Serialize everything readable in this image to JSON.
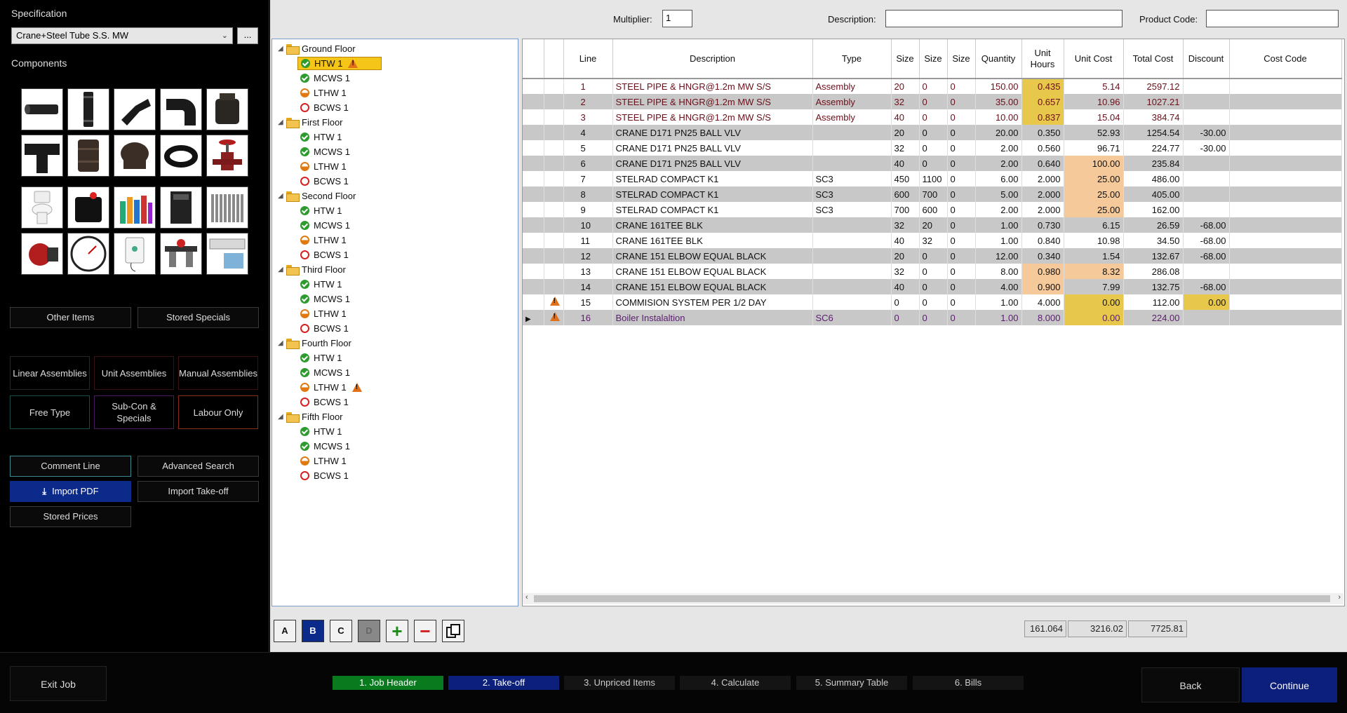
{
  "left": {
    "spec_label": "Specification",
    "spec_value": "Crane+Steel Tube S.S. MW",
    "spec_more": "...",
    "components_label": "Components",
    "components": [
      "pipe",
      "nipple",
      "elbow-45",
      "elbow",
      "cap-fitting",
      "tee",
      "socket",
      "plug",
      "flexible-hose",
      "gate-valve",
      "toilet",
      "pump-unit",
      "bottles",
      "boiler",
      "radiator",
      "circulator-pump",
      "pressure-gauge",
      "water-heater",
      "filter-regulator",
      "air-conditioner"
    ],
    "other_items": "Other Items",
    "stored_specials": "Stored Specials",
    "linear_assemblies": "Linear Assemblies",
    "unit_assemblies": "Unit Assemblies",
    "manual_assemblies": "Manual Assemblies",
    "free_type": "Free Type",
    "subcon": "Sub-Con & Specials",
    "labour_only": "Labour Only",
    "comment_line": "Comment Line",
    "advanced_search": "Advanced Search",
    "import_pdf": "Import PDF",
    "import_takeoff": "Import Take-off",
    "stored_prices": "Stored Prices"
  },
  "topbar": {
    "multiplier_label": "Multiplier:",
    "multiplier_value": "1",
    "description_label": "Description:",
    "description_value": "",
    "product_code_label": "Product Code:",
    "product_code_value": ""
  },
  "tree": {
    "floors": [
      {
        "name": "Ground Floor",
        "items": [
          {
            "label": "HTW  1",
            "status": "ok",
            "warn": true,
            "selected": true
          },
          {
            "label": "MCWS  1",
            "status": "ok"
          },
          {
            "label": "LTHW  1",
            "status": "half"
          },
          {
            "label": "BCWS  1",
            "status": "empty"
          }
        ]
      },
      {
        "name": "First Floor",
        "items": [
          {
            "label": "HTW  1",
            "status": "ok"
          },
          {
            "label": "MCWS  1",
            "status": "ok"
          },
          {
            "label": "LTHW  1",
            "status": "half"
          },
          {
            "label": "BCWS  1",
            "status": "empty"
          }
        ]
      },
      {
        "name": "Second Floor",
        "items": [
          {
            "label": "HTW  1",
            "status": "ok"
          },
          {
            "label": "MCWS  1",
            "status": "ok"
          },
          {
            "label": "LTHW  1",
            "status": "half"
          },
          {
            "label": "BCWS  1",
            "status": "empty"
          }
        ]
      },
      {
        "name": "Third Floor",
        "items": [
          {
            "label": "HTW  1",
            "status": "ok"
          },
          {
            "label": "MCWS  1",
            "status": "ok"
          },
          {
            "label": "LTHW  1",
            "status": "half"
          },
          {
            "label": "BCWS  1",
            "status": "empty"
          }
        ]
      },
      {
        "name": "Fourth Floor",
        "items": [
          {
            "label": "HTW  1",
            "status": "ok"
          },
          {
            "label": "MCWS  1",
            "status": "ok"
          },
          {
            "label": "LTHW  1",
            "status": "half",
            "warn": true
          },
          {
            "label": "BCWS  1",
            "status": "empty"
          }
        ]
      },
      {
        "name": "Fifth Floor",
        "items": [
          {
            "label": "HTW  1",
            "status": "ok"
          },
          {
            "label": "MCWS  1",
            "status": "ok"
          },
          {
            "label": "LTHW  1",
            "status": "half"
          },
          {
            "label": "BCWS  1",
            "status": "empty"
          }
        ]
      }
    ],
    "buttons": [
      "A",
      "B",
      "C",
      "D"
    ]
  },
  "grid": {
    "columns": [
      "",
      "",
      "Line",
      "Description",
      "Type",
      "Size",
      "Size",
      "Size",
      "Quantity",
      "Unit Hours",
      "Unit Cost",
      "Total Cost",
      "Discount",
      "Cost Code"
    ],
    "rows": [
      {
        "line": "1",
        "desc": "STEEL PIPE & HNGR@1.2m MW S/S",
        "type": "Assembly",
        "s1": "20",
        "s2": "0",
        "s3": "0",
        "qty": "150.00",
        "hrs": "0.435",
        "cost": "5.14",
        "total": "2597.12",
        "disc": "",
        "code": "",
        "color": "maroon",
        "hrs_hl": "y"
      },
      {
        "line": "2",
        "desc": "STEEL PIPE & HNGR@1.2m MW S/S",
        "type": "Assembly",
        "s1": "32",
        "s2": "0",
        "s3": "0",
        "qty": "35.00",
        "hrs": "0.657",
        "cost": "10.96",
        "total": "1027.21",
        "disc": "",
        "code": "",
        "color": "maroon",
        "hrs_hl": "y"
      },
      {
        "line": "3",
        "desc": "STEEL PIPE & HNGR@1.2m MW S/S",
        "type": "Assembly",
        "s1": "40",
        "s2": "0",
        "s3": "0",
        "qty": "10.00",
        "hrs": "0.837",
        "cost": "15.04",
        "total": "384.74",
        "disc": "",
        "code": "",
        "color": "maroon",
        "hrs_hl": "y"
      },
      {
        "line": "4",
        "desc": "CRANE D171 PN25   BALL VLV",
        "type": "",
        "s1": "20",
        "s2": "0",
        "s3": "0",
        "qty": "20.00",
        "hrs": "0.350",
        "cost": "52.93",
        "total": "1254.54",
        "disc": "-30.00",
        "code": ""
      },
      {
        "line": "5",
        "desc": "CRANE D171 PN25   BALL VLV",
        "type": "",
        "s1": "32",
        "s2": "0",
        "s3": "0",
        "qty": "2.00",
        "hrs": "0.560",
        "cost": "96.71",
        "total": "224.77",
        "disc": "-30.00",
        "code": ""
      },
      {
        "line": "6",
        "desc": "CRANE D171 PN25   BALL VLV",
        "type": "",
        "s1": "40",
        "s2": "0",
        "s3": "0",
        "qty": "2.00",
        "hrs": "0.640",
        "cost": "100.00",
        "total": "235.84",
        "disc": "",
        "code": "",
        "cost_hl": "o"
      },
      {
        "line": "7",
        "desc": "STELRAD COMPACT K1",
        "type": "SC3",
        "s1": "450",
        "s2": "1100",
        "s3": "0",
        "qty": "6.00",
        "hrs": "2.000",
        "cost": "25.00",
        "total": "486.00",
        "disc": "",
        "code": "",
        "cost_hl": "o"
      },
      {
        "line": "8",
        "desc": "STELRAD COMPACT K1",
        "type": "SC3",
        "s1": "600",
        "s2": "700",
        "s3": "0",
        "qty": "5.00",
        "hrs": "2.000",
        "cost": "25.00",
        "total": "405.00",
        "disc": "",
        "code": "",
        "cost_hl": "o"
      },
      {
        "line": "9",
        "desc": "STELRAD COMPACT K1",
        "type": "SC3",
        "s1": "700",
        "s2": "600",
        "s3": "0",
        "qty": "2.00",
        "hrs": "2.000",
        "cost": "25.00",
        "total": "162.00",
        "disc": "",
        "code": "",
        "cost_hl": "o"
      },
      {
        "line": "10",
        "desc": "CRANE 161TEE BLK",
        "type": "",
        "s1": "32",
        "s2": "20",
        "s3": "0",
        "qty": "1.00",
        "hrs": "0.730",
        "cost": "6.15",
        "total": "26.59",
        "disc": "-68.00",
        "code": ""
      },
      {
        "line": "11",
        "desc": "CRANE 161TEE BLK",
        "type": "",
        "s1": "40",
        "s2": "32",
        "s3": "0",
        "qty": "1.00",
        "hrs": "0.840",
        "cost": "10.98",
        "total": "34.50",
        "disc": "-68.00",
        "code": ""
      },
      {
        "line": "12",
        "desc": "CRANE 151 ELBOW EQUAL BLACK",
        "type": "",
        "s1": "20",
        "s2": "0",
        "s3": "0",
        "qty": "12.00",
        "hrs": "0.340",
        "cost": "1.54",
        "total": "132.67",
        "disc": "-68.00",
        "code": ""
      },
      {
        "line": "13",
        "desc": "CRANE 151 ELBOW EQUAL BLACK",
        "type": "",
        "s1": "32",
        "s2": "0",
        "s3": "0",
        "qty": "8.00",
        "hrs": "0.980",
        "cost": "8.32",
        "total": "286.08",
        "disc": "",
        "code": "",
        "hrs_hl": "o",
        "cost_hl": "o"
      },
      {
        "line": "14",
        "desc": "CRANE 151 ELBOW EQUAL BLACK",
        "type": "",
        "s1": "40",
        "s2": "0",
        "s3": "0",
        "qty": "4.00",
        "hrs": "0.900",
        "cost": "7.99",
        "total": "132.75",
        "disc": "-68.00",
        "code": "",
        "hrs_hl": "o"
      },
      {
        "line": "15",
        "desc": "COMMISION SYSTEM PER 1/2  DAY",
        "type": "",
        "s1": "0",
        "s2": "0",
        "s3": "0",
        "qty": "1.00",
        "hrs": "4.000",
        "cost": "0.00",
        "total": "112.00",
        "disc": "0.00",
        "code": "",
        "warn": true,
        "cost_hl": "y",
        "disc_hl": "y"
      },
      {
        "line": "16",
        "desc": "Boiler Instalaltion",
        "type": "SC6",
        "s1": "0",
        "s2": "0",
        "s3": "0",
        "qty": "1.00",
        "hrs": "8.000",
        "cost": "0.00",
        "total": "224.00",
        "disc": "",
        "code": "",
        "warn": true,
        "current": true,
        "color": "purple",
        "cost_hl": "y"
      }
    ],
    "totals": {
      "hours": "161.064",
      "cost": "3216.02",
      "total": "7725.81"
    }
  },
  "bottom": {
    "exit": "Exit Job",
    "steps": [
      "1. Job Header",
      "2. Take-off",
      "3. Unpriced Items",
      "4. Calculate",
      "5. Summary Table",
      "6. Bills"
    ],
    "back": "Back",
    "continue": "Continue"
  },
  "colors": {
    "active_step": "#0a7a1e",
    "current_step": "#0c1f7a",
    "continue": "#0c1f7a",
    "highlight_yellow": "#e8c84a",
    "highlight_orange": "#f6c99a"
  }
}
